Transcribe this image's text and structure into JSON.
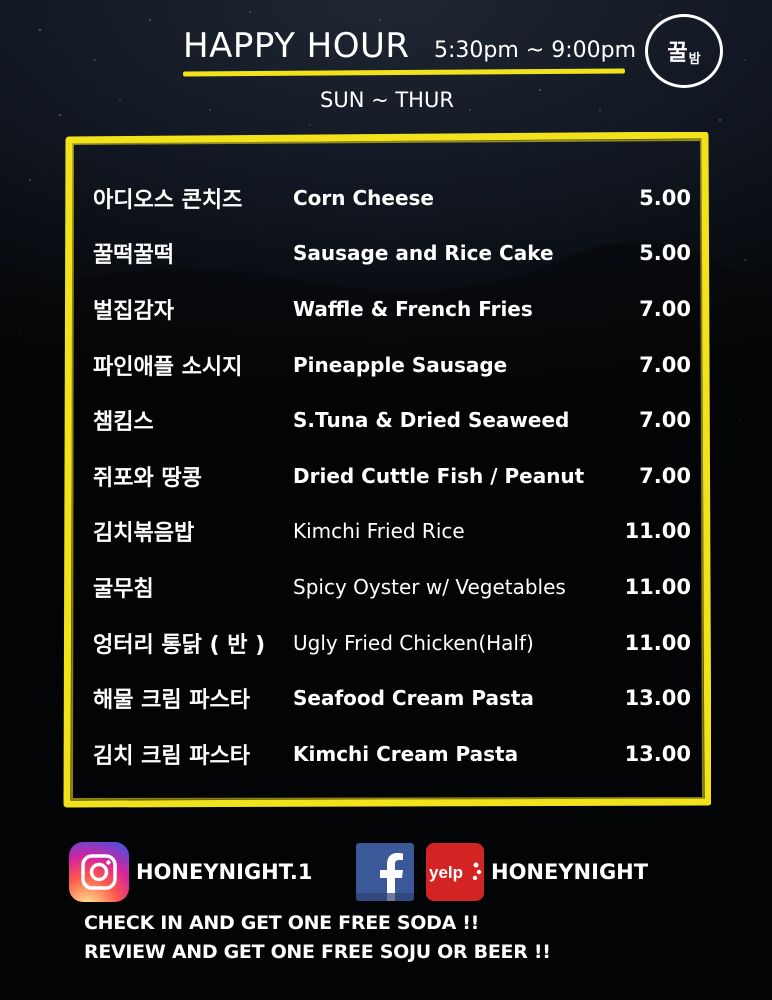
{
  "header": {
    "title": "HAPPY HOUR",
    "hours": "5:30pm ~ 9:00pm",
    "days": "SUN ~ THUR",
    "logo_main": "꿀",
    "logo_small": "밤"
  },
  "menu": [
    {
      "ko": "아디오스 콘치즈",
      "en": "Corn Cheese",
      "price": "5.00",
      "weight": "bold"
    },
    {
      "ko": "꿀떡꿀떡",
      "en": "Sausage and Rice Cake",
      "price": "5.00",
      "weight": "bold"
    },
    {
      "ko": "벌집감자",
      "en": "Waffle & French Fries",
      "price": "7.00",
      "weight": "bold"
    },
    {
      "ko": "파인애플 소시지",
      "en": "Pineapple Sausage",
      "price": "7.00",
      "weight": "bold"
    },
    {
      "ko": "챔킴스",
      "en": "S.Tuna & Dried Seaweed",
      "price": "7.00",
      "weight": "bold"
    },
    {
      "ko": "쥐포와 땅콩",
      "en": "Dried Cuttle Fish / Peanut",
      "price": "7.00",
      "weight": "bold"
    },
    {
      "ko": "김치볶음밥",
      "en": "Kimchi Fried Rice",
      "price": "11.00",
      "weight": "light"
    },
    {
      "ko": "굴무침",
      "en": "Spicy Oyster w/ Vegetables",
      "price": "11.00",
      "weight": "light"
    },
    {
      "ko": "엉터리 통닭 ( 반 )",
      "en": "Ugly Fried Chicken(Half)",
      "price": "11.00",
      "weight": "light"
    },
    {
      "ko": "해물 크림 파스타",
      "en": "Seafood Cream Pasta",
      "price": "13.00",
      "weight": "bold"
    },
    {
      "ko": "김치 크림 파스타",
      "en": "Kimchi Cream Pasta",
      "price": "13.00",
      "weight": "bold"
    }
  ],
  "social": {
    "instagram_icon": "instagram-icon",
    "instagram_handle": "HONEYNIGHT.1",
    "facebook_icon": "facebook-icon",
    "yelp_icon": "yelp-icon",
    "yelp_label": "yelp",
    "yelp_handle": "HONEYNIGHT"
  },
  "promos": [
    "CHECK IN AND GET ONE FREE SODA !!",
    "REVIEW AND GET ONE FREE SOJU OR BEER !!"
  ],
  "colors": {
    "accent": "#f2e21c",
    "background": "#000000",
    "text": "#ffffff"
  }
}
